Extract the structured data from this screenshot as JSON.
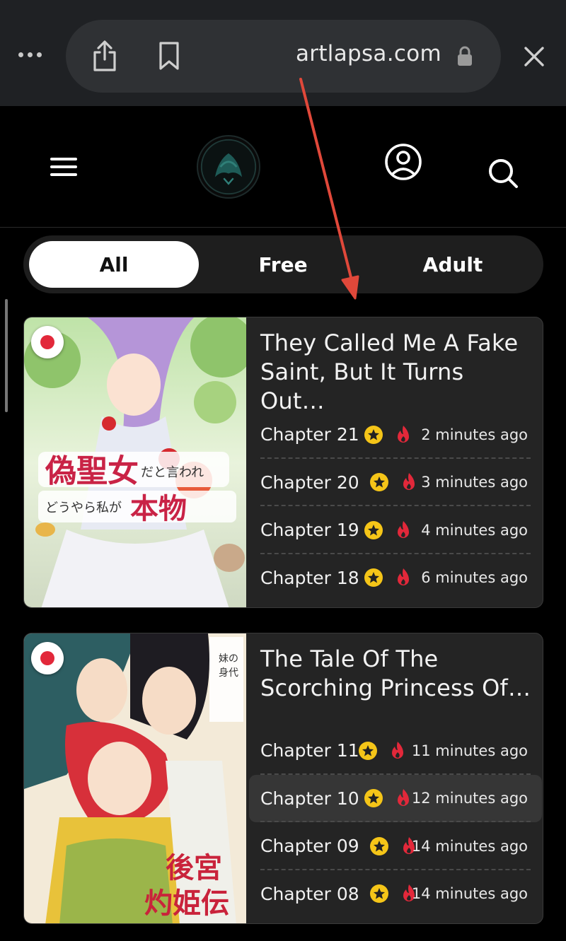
{
  "browser": {
    "url": "artlapsa.com",
    "icons": [
      "more-icon",
      "share-icon",
      "bookmark-icon",
      "lock-icon",
      "close-icon"
    ]
  },
  "header": {
    "icons": [
      "hamburger-icon",
      "site-logo",
      "user-icon",
      "search-icon"
    ]
  },
  "tabs": [
    {
      "label": "All",
      "active": true
    },
    {
      "label": "Free",
      "active": false
    },
    {
      "label": "Adult",
      "active": false
    }
  ],
  "cards": [
    {
      "title": "They Called Me A Fake Saint, But It Turns Out…",
      "chapters": [
        {
          "label": "Chapter 21",
          "time": "2 minutes ago"
        },
        {
          "label": "Chapter 20",
          "time": "3 minutes ago"
        },
        {
          "label": "Chapter 19",
          "time": "4 minutes ago"
        },
        {
          "label": "Chapter 18",
          "time": "6 minutes ago"
        }
      ]
    },
    {
      "title": "The Tale Of The Scorching Princess Of…",
      "chapters": [
        {
          "label": "Chapter 11",
          "time": "11 minutes ago"
        },
        {
          "label": "Chapter 10",
          "time": "12 minutes ago"
        },
        {
          "label": "Chapter 09",
          "time": "14 minutes ago"
        },
        {
          "label": "Chapter 08",
          "time": "14 minutes ago"
        }
      ]
    }
  ],
  "colors": {
    "accent_red": "#e2283a",
    "star_yellow": "#f5c518",
    "annotation_arrow": "#e0483a"
  }
}
